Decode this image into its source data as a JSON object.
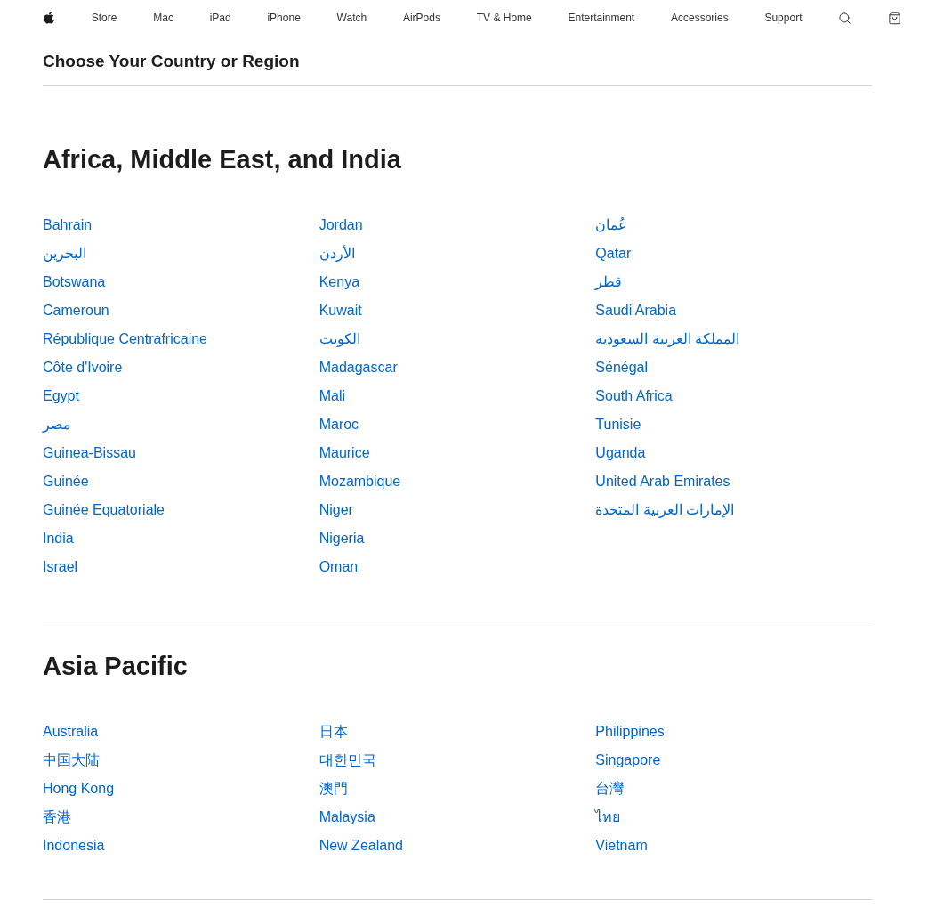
{
  "nav": {
    "items": [
      "Store",
      "Mac",
      "iPad",
      "iPhone",
      "Watch",
      "AirPods",
      "TV & Home",
      "Entertainment",
      "Accessories",
      "Support"
    ]
  },
  "page_title": "Choose Your Country or Region",
  "sections": [
    {
      "title": "Africa, Middle East, and India",
      "columns": [
        {
          "links": [
            "Bahrain",
            "البحرين",
            "Botswana",
            "Cameroun",
            "République Centrafricaine",
            "Côte d'Ivoire",
            "Egypt",
            "مصر",
            "Guinea-Bissau",
            "Guinée",
            "Guinée Equatoriale",
            "India",
            "Israel"
          ]
        },
        {
          "links": [
            "Jordan",
            "الأردن",
            "Kenya",
            "Kuwait",
            "الكويت",
            "Madagascar",
            "Mali",
            "Maroc",
            "Maurice",
            "Mozambique",
            "Niger",
            "Nigeria",
            "Oman"
          ]
        },
        {
          "links": [
            "عُمان",
            "Qatar",
            "قطر",
            "Saudi Arabia",
            "المملكة العربية السعودية",
            "Sénégal",
            "South Africa",
            "Tunisie",
            "Uganda",
            "United Arab Emirates",
            "الإمارات العربية المتحدة"
          ]
        }
      ]
    },
    {
      "title": "Asia Pacific",
      "columns": [
        {
          "links": [
            "Australia",
            "中国大陆",
            "Hong Kong",
            "香港",
            "Indonesia"
          ]
        },
        {
          "links": [
            "日本",
            "대한민국",
            "澳門",
            "Malaysia",
            "New Zealand"
          ]
        },
        {
          "links": [
            "Philippines",
            "Singapore",
            "台灣",
            "ไทย",
            "Vietnam"
          ]
        }
      ]
    }
  ]
}
